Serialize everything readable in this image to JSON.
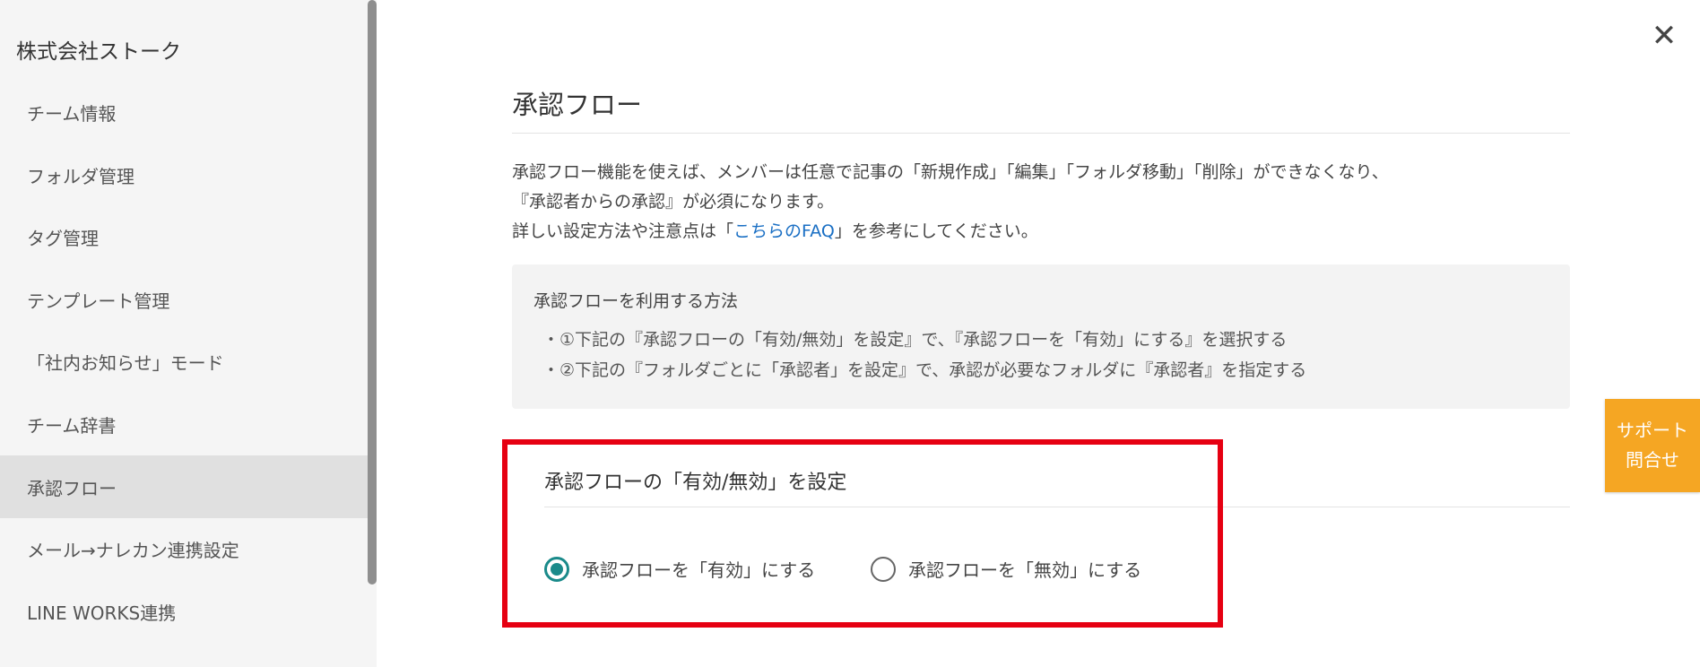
{
  "sidebar": {
    "company": "株式会社ストーク",
    "items": [
      {
        "label": "チーム情報"
      },
      {
        "label": "フォルダ管理"
      },
      {
        "label": "タグ管理"
      },
      {
        "label": "テンプレート管理"
      },
      {
        "label": "「社内お知らせ」モード"
      },
      {
        "label": "チーム辞書"
      },
      {
        "label": "承認フロー"
      },
      {
        "label": "メール→ナレカン連携設定"
      },
      {
        "label": "LINE WORKS連携"
      }
    ],
    "active_item": "承認フロー"
  },
  "close_button": {
    "icon": "close-icon",
    "symbol": "✕"
  },
  "main": {
    "title": "承認フロー",
    "desc_line1": "承認フロー機能を使えば、メンバーは任意で記事の「新規作成」「編集」「フォルダ移動」「削除」ができなくなり、",
    "desc_line2": "『承認者からの承認』が必須になります。",
    "desc_line3_pre": "詳しい設定方法や注意点は「",
    "desc_link": "こちらのFAQ",
    "desc_line3_post": "」を参考にしてください。",
    "howto": {
      "title": "承認フローを利用する方法",
      "step1": "・①下記の『承認フローの「有効/無効」を設定』で、『承認フローを「有効」にする』を選択する",
      "step2": "・②下記の『フォルダごとに「承認者」を設定』で、承認が必要なフォルダに『承認者』を指定する"
    },
    "setting": {
      "title": "承認フローの「有効/無効」を設定",
      "option_enable": "承認フローを「有効」にする",
      "option_disable": "承認フローを「無効」にする",
      "selected": "enable"
    }
  },
  "support": {
    "line1": "サポート",
    "line2": "問合せ"
  },
  "colors": {
    "accent": "#1a8a8a",
    "link": "#1a6fc4",
    "highlight": "#e60012",
    "support_bg": "#f5a623"
  }
}
